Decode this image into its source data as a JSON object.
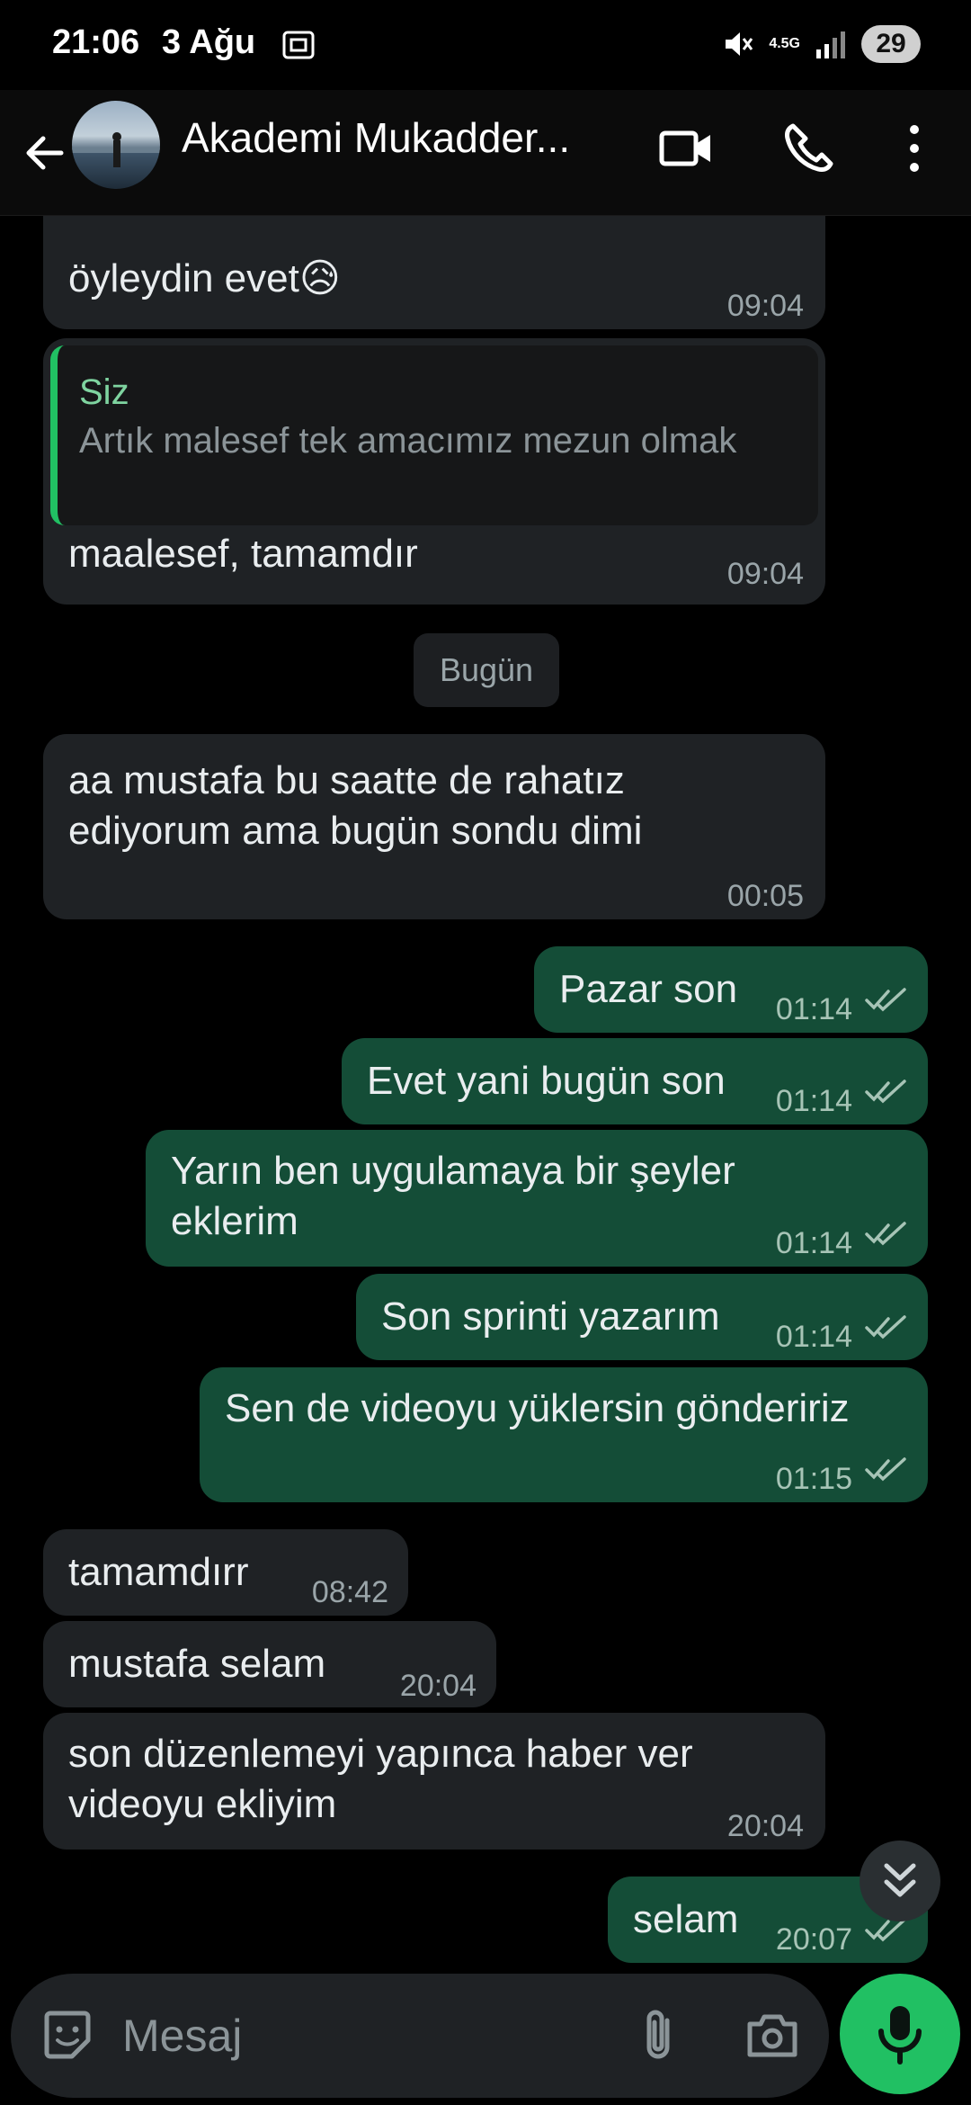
{
  "status_bar": {
    "time": "21:06",
    "date": "3 Ağu",
    "network": "4.5G",
    "battery": "29"
  },
  "header": {
    "contact_name": "Akademi Mukadder..."
  },
  "messages": [
    {
      "text": "öyleydin evet😥",
      "time": "09:04"
    },
    {
      "quote_author": "Siz",
      "quote_text": "Artık malesef tek amacımız mezun olmak",
      "text": "maalesef, tamamdır",
      "time": "09:04"
    },
    {
      "text": "aa mustafa bu saatte de rahatız ediyorum ama bugün sondu dimi",
      "time": "00:05"
    },
    {
      "text": "Pazar son",
      "time": "01:14"
    },
    {
      "text": "Evet yani bugün son",
      "time": "01:14"
    },
    {
      "text": "Yarın ben uygulamaya bir şeyler eklerim",
      "time": "01:14"
    },
    {
      "text": "Son sprinti yazarım",
      "time": "01:14"
    },
    {
      "text": "Sen de videoyu yüklersin göndeririz",
      "time": "01:15"
    },
    {
      "text": "tamamdırr",
      "time": "08:42"
    },
    {
      "text": "mustafa selam",
      "time": "20:04"
    },
    {
      "text": "son düzenlemeyi yapınca haber ver videoyu ekliyim",
      "time": "20:04"
    },
    {
      "text": "selam",
      "time": "20:07"
    }
  ],
  "date_divider": "Bugün",
  "composer": {
    "placeholder": "Mesaj"
  }
}
